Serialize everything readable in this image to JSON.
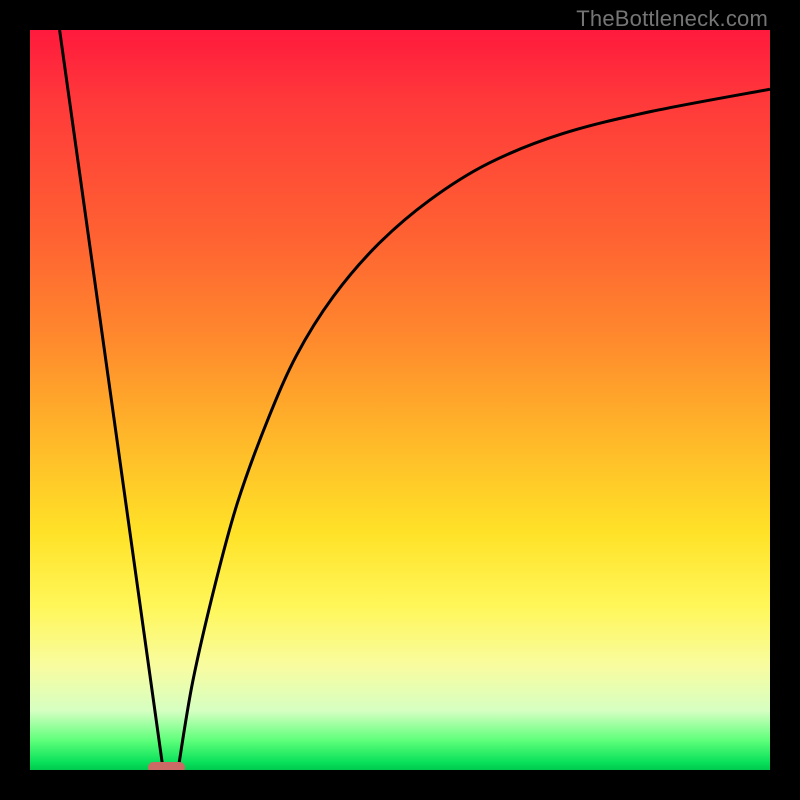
{
  "watermark": "TheBottleneck.com",
  "frame": {
    "outer_w": 800,
    "outer_h": 800,
    "inner_x": 30,
    "inner_y": 30,
    "inner_w": 740,
    "inner_h": 740,
    "border_color": "#000000"
  },
  "gradient_stops": [
    {
      "pct": 0,
      "color": "#ff1a3d"
    },
    {
      "pct": 10,
      "color": "#ff3a3a"
    },
    {
      "pct": 28,
      "color": "#ff6232"
    },
    {
      "pct": 42,
      "color": "#ff8a2d"
    },
    {
      "pct": 55,
      "color": "#ffb729"
    },
    {
      "pct": 68,
      "color": "#ffe228"
    },
    {
      "pct": 78,
      "color": "#fff75a"
    },
    {
      "pct": 86,
      "color": "#f8fca0"
    },
    {
      "pct": 92,
      "color": "#d6ffc2"
    },
    {
      "pct": 96,
      "color": "#5eff7a"
    },
    {
      "pct": 99,
      "color": "#08e05a"
    },
    {
      "pct": 100,
      "color": "#00c94d"
    }
  ],
  "chart_data": {
    "type": "line",
    "title": "",
    "xlabel": "",
    "ylabel": "",
    "xlim": [
      0,
      100
    ],
    "ylim": [
      0,
      100
    ],
    "series": [
      {
        "name": "left-line",
        "x": [
          4,
          18
        ],
        "values": [
          100,
          0
        ]
      },
      {
        "name": "right-curve",
        "x": [
          20,
          22,
          25,
          28,
          32,
          36,
          41,
          47,
          54,
          62,
          72,
          84,
          100
        ],
        "values": [
          0,
          12,
          25,
          36,
          47,
          56,
          64,
          71,
          77,
          82,
          86,
          89,
          92
        ]
      }
    ],
    "marker": {
      "name": "bottom-pill",
      "x_center": 18.5,
      "y_center": 0.3,
      "width": 5,
      "height": 1.5,
      "color": "#cc6b66"
    }
  }
}
